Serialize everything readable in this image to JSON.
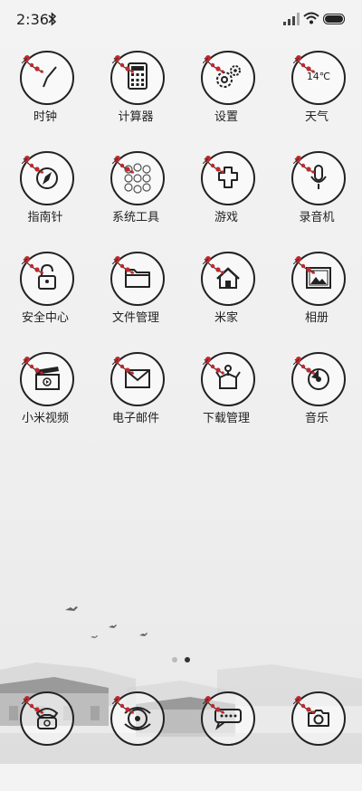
{
  "status": {
    "time": "2:36"
  },
  "apps": [
    {
      "name": "时钟",
      "icon": "clock-icon"
    },
    {
      "name": "计算器",
      "icon": "calculator-icon"
    },
    {
      "name": "设置",
      "icon": "settings-icon"
    },
    {
      "name": "天气",
      "icon": "weather-icon",
      "text": "14℃"
    },
    {
      "name": "指南针",
      "icon": "compass-icon"
    },
    {
      "name": "系统工具",
      "icon": "system-tools-icon"
    },
    {
      "name": "游戏",
      "icon": "game-icon"
    },
    {
      "name": "录音机",
      "icon": "microphone-icon"
    },
    {
      "name": "安全中心",
      "icon": "lock-icon"
    },
    {
      "name": "文件管理",
      "icon": "folder-icon"
    },
    {
      "name": "米家",
      "icon": "home-icon"
    },
    {
      "name": "相册",
      "icon": "gallery-icon"
    },
    {
      "name": "小米视频",
      "icon": "video-icon"
    },
    {
      "name": "电子邮件",
      "icon": "mail-icon"
    },
    {
      "name": "下载管理",
      "icon": "download-icon"
    },
    {
      "name": "音乐",
      "icon": "music-icon"
    }
  ],
  "page_indicator": {
    "total": 2,
    "active": 1
  },
  "dock": [
    {
      "icon": "phone-icon"
    },
    {
      "icon": "browser-icon"
    },
    {
      "icon": "messages-icon"
    },
    {
      "icon": "camera-icon"
    }
  ],
  "colors": {
    "ring": "#222222",
    "blossom": "#c0282d",
    "background": "#f0f0f0"
  }
}
